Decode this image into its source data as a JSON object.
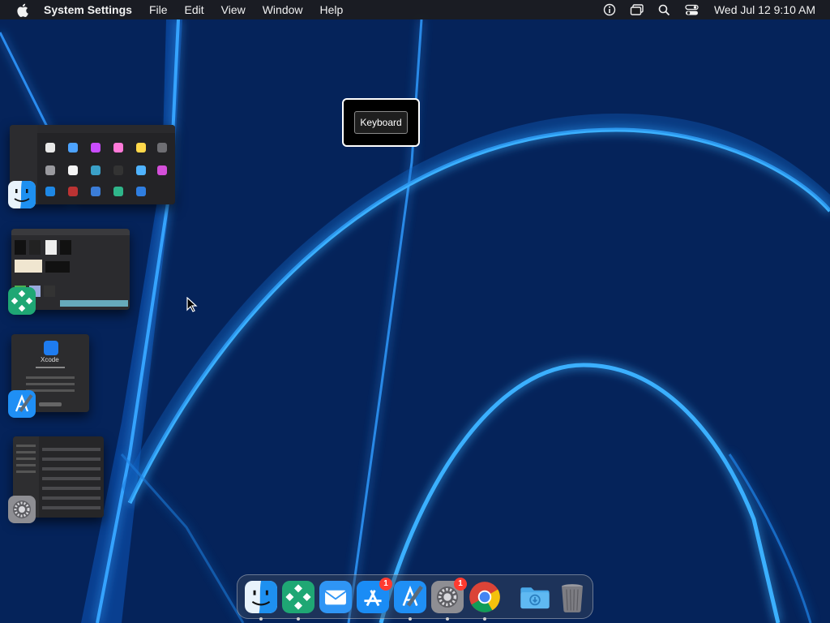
{
  "menubar": {
    "app_name": "System Settings",
    "items": [
      "File",
      "Edit",
      "View",
      "Window",
      "Help"
    ],
    "clock": "Wed Jul 12  9:10 AM",
    "status_icons": [
      "info-icon",
      "screen-mirroring-icon",
      "spotlight-search-icon",
      "control-center-icon"
    ]
  },
  "hud": {
    "label": "Keyboard"
  },
  "stage_manager": {
    "windows": [
      {
        "app": "Finder",
        "icon": "finder-icon"
      },
      {
        "app": "Elements",
        "icon": "green-diamond-icon"
      },
      {
        "app": "Xcode",
        "icon": "xcode-icon",
        "title_text": "Xcode"
      },
      {
        "app": "System Settings",
        "icon": "system-settings-icon"
      }
    ]
  },
  "dock": {
    "items": [
      {
        "name": "Finder",
        "icon": "finder-icon",
        "running": true
      },
      {
        "name": "Green App",
        "icon": "green-diamond-icon",
        "running": true
      },
      {
        "name": "Mail",
        "icon": "mail-icon",
        "running": false
      },
      {
        "name": "App Store",
        "icon": "app-store-icon",
        "running": false,
        "badge": "1"
      },
      {
        "name": "Xcode",
        "icon": "xcode-icon",
        "running": true
      },
      {
        "name": "System Settings",
        "icon": "system-settings-icon",
        "running": true,
        "badge": "1"
      },
      {
        "name": "Chrome",
        "icon": "chrome-icon",
        "running": true
      },
      {
        "name": "Downloads",
        "icon": "downloads-folder-icon",
        "running": false
      },
      {
        "name": "Trash",
        "icon": "trash-icon",
        "running": false
      }
    ]
  },
  "colors": {
    "wallpaper_dark": "#041a3f",
    "wallpaper_glow": "#1e90ff",
    "menubar": "#1c1c1e",
    "badge_red": "#ff3b30"
  }
}
